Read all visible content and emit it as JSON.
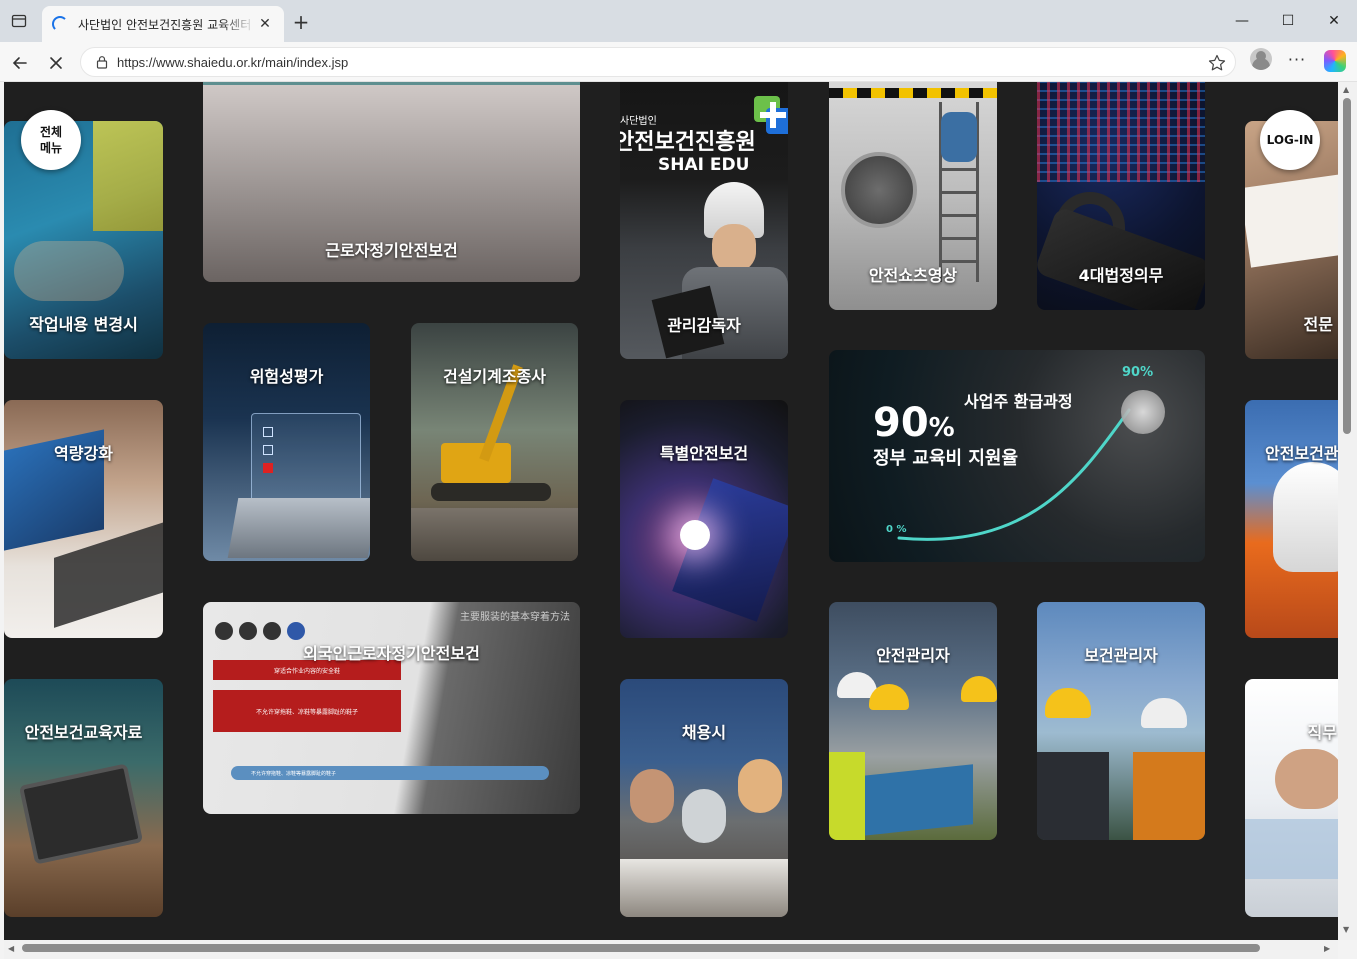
{
  "browser": {
    "tab_title": "사단법인 안전보건진흥원 교육센터",
    "url": "https://www.shaiedu.or.kr/main/index.jsp",
    "new_tab": "+",
    "close_tab": "✕",
    "minimize": "—",
    "maximize": "☐",
    "close_window": "✕",
    "more": "···"
  },
  "nav": {
    "menu_label_1": "전체",
    "menu_label_2": "메뉴",
    "login_label": "LOG-IN"
  },
  "brand": {
    "org_small": "사단법인",
    "org_name": "안전보건진흥원",
    "logo_text": "SHAI EDU",
    "accent_green": "#6cc04a",
    "accent_blue": "#1e6fd9"
  },
  "cards": [
    {
      "label": "작업내용 변경시"
    },
    {
      "label": "근로자정기안전보건"
    },
    {
      "label": "관리감독자"
    },
    {
      "label": "안전쇼츠영상"
    },
    {
      "label": "4대법정의무"
    },
    {
      "label": "전문"
    },
    {
      "label": "역량강화"
    },
    {
      "label": "위험성평가"
    },
    {
      "label": "건설기계조종사"
    },
    {
      "label": "특별안전보건"
    },
    {
      "label": "안전보건관"
    },
    {
      "label": "안전보건교육자료"
    },
    {
      "label": "외국인근로자정기안전보건"
    },
    {
      "label": "채용시"
    },
    {
      "label": "안전관리자"
    },
    {
      "label": "보건관리자"
    },
    {
      "label": "직무"
    }
  ],
  "promo": {
    "title": "사업주 환급과정",
    "big_value": "90",
    "big_unit": "%",
    "subtitle": "정부 교육비 지원율",
    "axis_start": "0 %",
    "axis_end": "90%"
  },
  "foreign_card": {
    "heading": "主要服装的基本穿着方法",
    "line1": "穿适合作业内容的安全鞋",
    "line2": "不允许穿拖鞋、凉鞋等暴露脚趾的鞋子",
    "line3": "不允许穿拖鞋、凉鞋等暴露脚趾的鞋子"
  }
}
